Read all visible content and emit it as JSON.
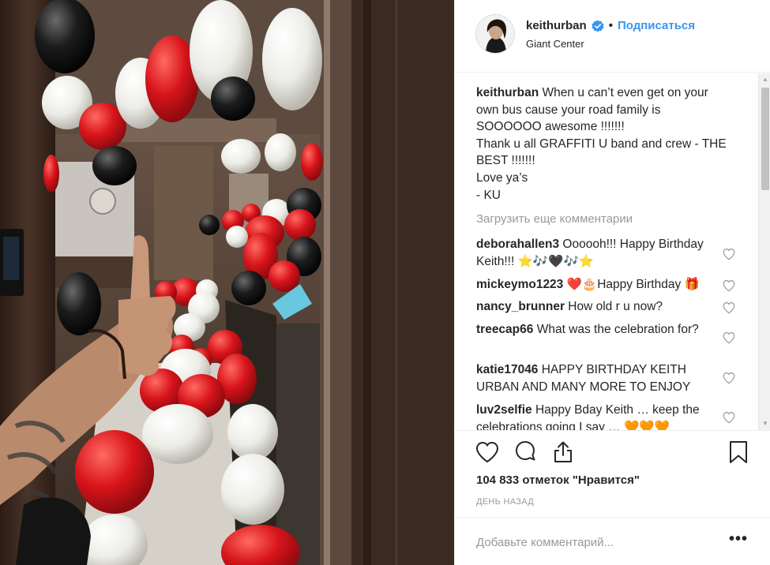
{
  "post": {
    "username": "keithurban",
    "follow_label": "Подписаться",
    "separator": "•",
    "location": "Giant Center"
  },
  "caption": {
    "username": "keithurban",
    "lines": [
      "When u can’t even get on your",
      "own bus cause your road family is",
      "SOOOOOO awesome !!!!!!!",
      "Thank u all GRAFFITI U band and crew - THE",
      "BEST !!!!!!!",
      "Love ya’s",
      "- KU"
    ]
  },
  "load_more_label": "Загрузить еще комментарии",
  "comments": [
    {
      "username": "deborahallen3",
      "text": "Oooooh!!! Happy Birthday Keith!!! ⭐🎶🖤🎶⭐"
    },
    {
      "username": "mickeymo1223",
      "text": "❤️🎂Happy Birthday 🎁"
    },
    {
      "username": "nancy_brunner",
      "text": "How old r u now?"
    },
    {
      "username": "treecap66",
      "text": "What was the celebration for?"
    },
    {
      "username": "katie17046",
      "text": "HAPPY BIRTHDAY KEITH URBAN AND MANY MORE TO ENJOY"
    },
    {
      "username": "luv2selfie",
      "text": "Happy Bday Keith … keep the celebrations going I say … 🧡🧡🧡"
    }
  ],
  "actions": {
    "like_icon": "heart-icon",
    "comment_icon": "comment-icon",
    "share_icon": "share-icon",
    "save_icon": "bookmark-icon"
  },
  "likes_text": "104 833 отметок \"Нравится\"",
  "timestamp": "ДЕНЬ НАЗАД",
  "add_comment_placeholder": "Добавьте комментарий...",
  "more_label": "•••",
  "colors": {
    "link": "#3897f0",
    "text": "#262626",
    "muted": "#999999",
    "balloon_red": "#d8141b",
    "balloon_white": "#f2f2ee"
  }
}
